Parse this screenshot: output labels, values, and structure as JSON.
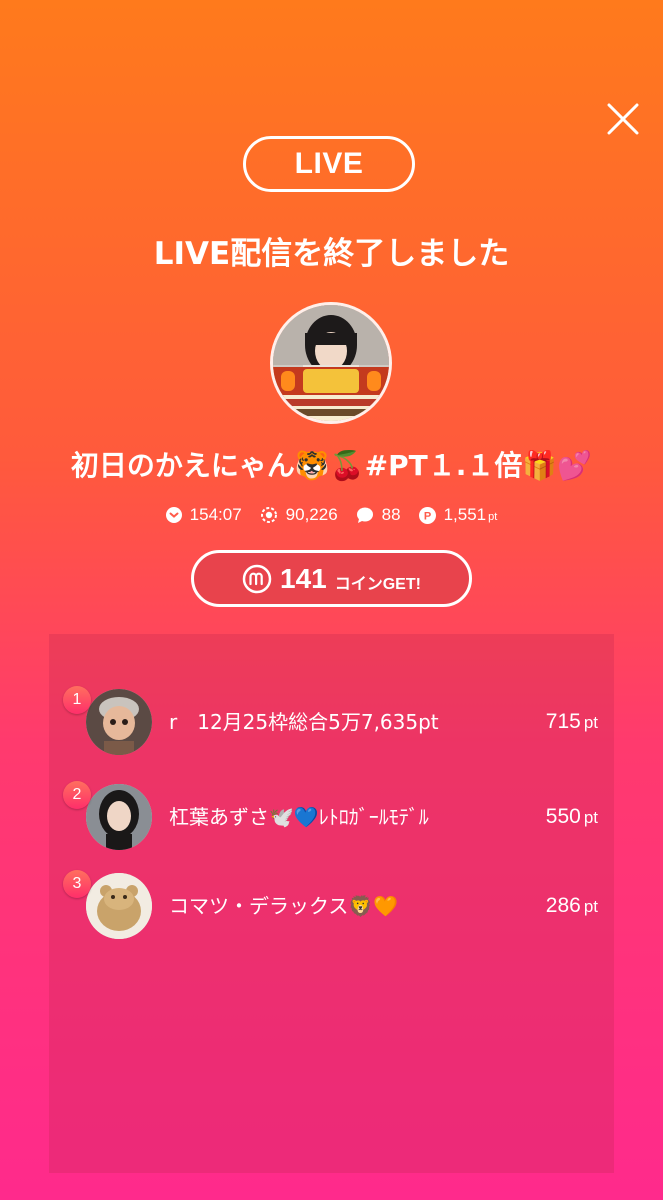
{
  "header": {
    "live_badge": "LIVE",
    "end_message": "LIVE配信を終了しました"
  },
  "stream": {
    "title": "初日のかえにゃん🐯🍒#PT１.１倍🎁💕",
    "stats": {
      "duration": "154:07",
      "viewers": "90,226",
      "comments": "88",
      "points": "1,551",
      "points_unit": "pt"
    }
  },
  "coins": {
    "amount": "141",
    "label": "コインGET!"
  },
  "ranking": [
    {
      "rank": "1",
      "name": "r　12月25枠総合5万7,635pt",
      "points": "715",
      "unit": "pt"
    },
    {
      "rank": "2",
      "name": "杠葉あずさ🕊️💙ﾚﾄﾛｶﾞｰﾙﾓﾃﾞﾙ",
      "points": "550",
      "unit": "pt"
    },
    {
      "rank": "3",
      "name": "コマツ・デラックス🦁🧡",
      "points": "286",
      "unit": "pt"
    }
  ],
  "icons": {
    "close": "close-icon",
    "duration": "chevron-circle-icon",
    "viewers": "eye-icon",
    "comments": "speech-bubble-icon",
    "points": "point-coin-icon",
    "coin": "m-coin-icon"
  },
  "colors": {
    "gradient_top": "#ff7a1c",
    "gradient_bottom": "#ff2a8c",
    "coin_pill_bg": "#e8434c",
    "rank_badge": "#ff3a68"
  }
}
